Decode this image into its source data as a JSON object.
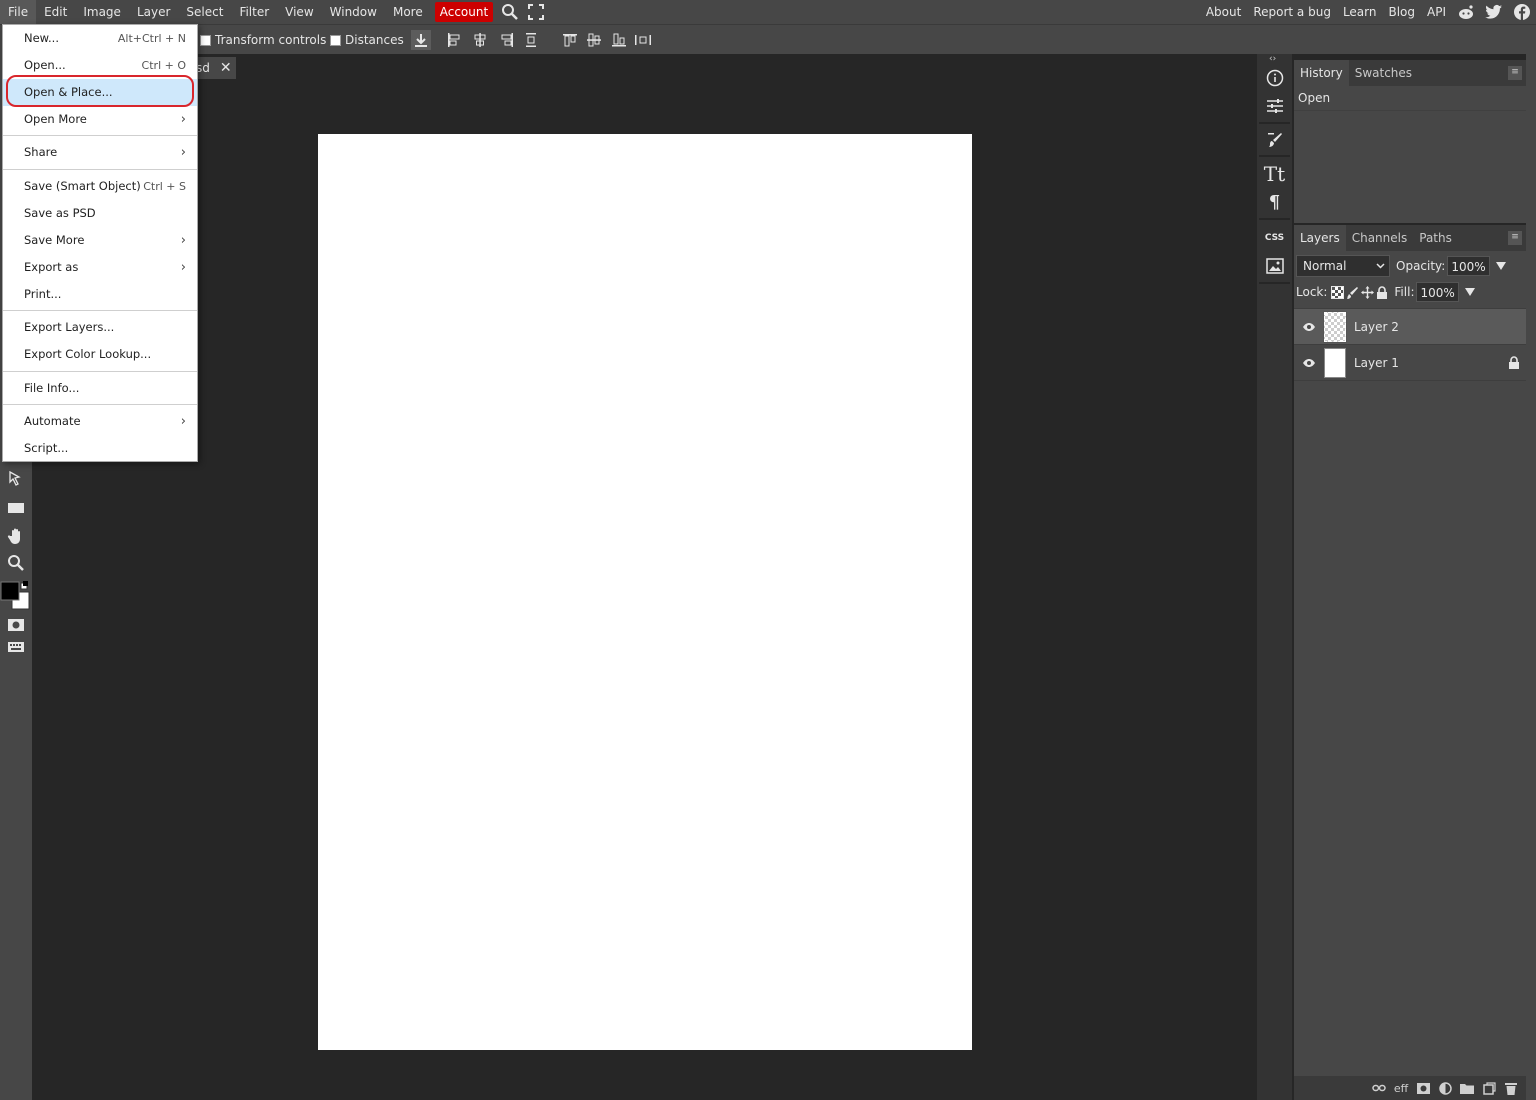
{
  "menubar": {
    "items": [
      "File",
      "Edit",
      "Image",
      "Layer",
      "Select",
      "Filter",
      "View",
      "Window",
      "More",
      "Account"
    ],
    "right_links": [
      "About",
      "Report a bug",
      "Learn",
      "Blog",
      "API"
    ]
  },
  "options": {
    "transform_label": "Transform controls",
    "distances_label": "Distances"
  },
  "doc_tab": {
    "name": "sd",
    "close": "✕"
  },
  "file_menu": {
    "items": [
      {
        "label": "New...",
        "shortcut": "Alt+Ctrl + N"
      },
      {
        "label": "Open...",
        "shortcut": "Ctrl + O"
      },
      {
        "label": "Open & Place..."
      },
      {
        "label": "Open More",
        "arrow": "›"
      },
      {
        "label": "Share",
        "arrow": "›"
      },
      {
        "label": "Save (Smart Object)",
        "shortcut": "Ctrl + S"
      },
      {
        "label": "Save as PSD"
      },
      {
        "label": "Save More",
        "arrow": "›"
      },
      {
        "label": "Export as",
        "arrow": "›"
      },
      {
        "label": "Print..."
      },
      {
        "label": "Export Layers..."
      },
      {
        "label": "Export Color Lookup..."
      },
      {
        "label": "File Info..."
      },
      {
        "label": "Automate",
        "arrow": "›"
      },
      {
        "label": "Script..."
      }
    ]
  },
  "history_panel": {
    "tabs": [
      "History",
      "Swatches"
    ],
    "entries": [
      "Open"
    ],
    "menu": "≡"
  },
  "layers_panel": {
    "tabs": [
      "Layers",
      "Channels",
      "Paths"
    ],
    "menu": "≡",
    "blend_mode": "Normal",
    "opacity_label": "Opacity:",
    "opacity_value": "100%",
    "lock_label": "Lock:",
    "fill_label": "Fill:",
    "fill_value": "100%",
    "layers": [
      {
        "name": "Layer 2"
      },
      {
        "name": "Layer 1"
      }
    ],
    "footer_eff": "eff"
  },
  "right_strip": {
    "css_label": "CSS"
  },
  "colors": {
    "accent_account": "#cc0000",
    "highlight": "#cfe8fb",
    "ring": "#d9262c"
  }
}
